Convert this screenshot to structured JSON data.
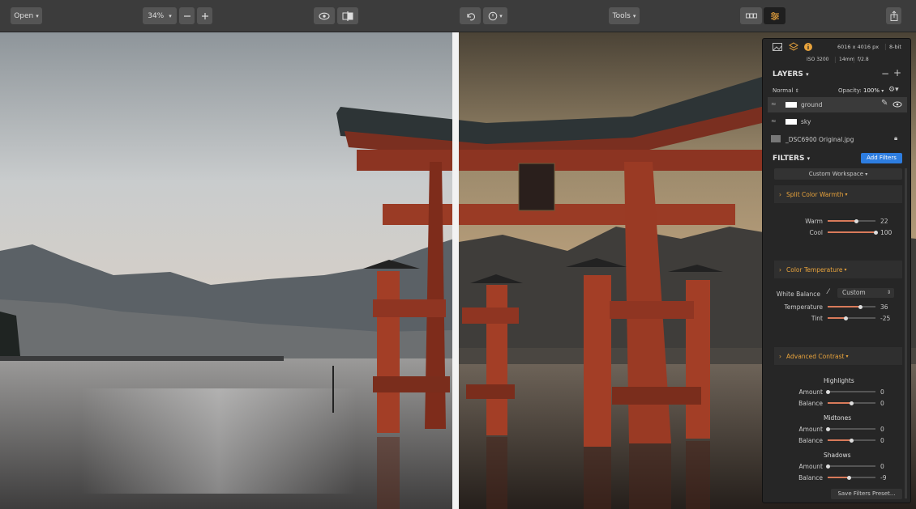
{
  "toolbar": {
    "open_label": "Open",
    "zoom_label": "34%",
    "tools_label": "Tools"
  },
  "panel": {
    "image_info": {
      "dimensions": "6016 x 4016 px",
      "bit_depth": "8-bit",
      "iso": "ISO 3200",
      "focal": "14mm",
      "aperture": "f/2.8"
    },
    "layers": {
      "title": "LAYERS",
      "blend_mode": "Normal",
      "opacity_label": "Opacity:",
      "opacity_value": "100%",
      "items": [
        {
          "name": "ground"
        },
        {
          "name": "sky"
        },
        {
          "name": "_DSC6900 Original.jpg"
        }
      ]
    },
    "filters": {
      "title": "FILTERS",
      "add_button": "Add Filters",
      "workspace": "Custom Workspace",
      "split_color": {
        "title": "Split Color Warmth",
        "rows": [
          {
            "label": "Warm",
            "value": "22",
            "fraction": 0.61
          },
          {
            "label": "Cool",
            "value": "100",
            "fraction": 1.0
          }
        ]
      },
      "color_temp": {
        "title": "Color Temperature",
        "wb_label": "White Balance",
        "wb_value": "Custom",
        "rows": [
          {
            "label": "Temperature",
            "value": "36",
            "fraction": 0.68
          },
          {
            "label": "Tint",
            "value": "-25",
            "fraction": 0.375
          }
        ]
      },
      "adv_contrast": {
        "title": "Advanced Contrast",
        "groups": [
          {
            "title": "Highlights",
            "rows": [
              {
                "label": "Amount",
                "value": "0",
                "fraction": 0.0
              },
              {
                "label": "Balance",
                "value": "0",
                "fraction": 0.5
              }
            ]
          },
          {
            "title": "Midtones",
            "rows": [
              {
                "label": "Amount",
                "value": "0",
                "fraction": 0.0
              },
              {
                "label": "Balance",
                "value": "0",
                "fraction": 0.5
              }
            ]
          },
          {
            "title": "Shadows",
            "rows": [
              {
                "label": "Amount",
                "value": "0",
                "fraction": 0.0
              },
              {
                "label": "Balance",
                "value": "-9",
                "fraction": 0.455
              }
            ]
          }
        ]
      },
      "save_preset": "Save Filters Preset..."
    }
  },
  "colors": {
    "accent_orange": "#e8a33c",
    "accent_blue": "#2d7de0",
    "torii_red": "#b5422a"
  }
}
